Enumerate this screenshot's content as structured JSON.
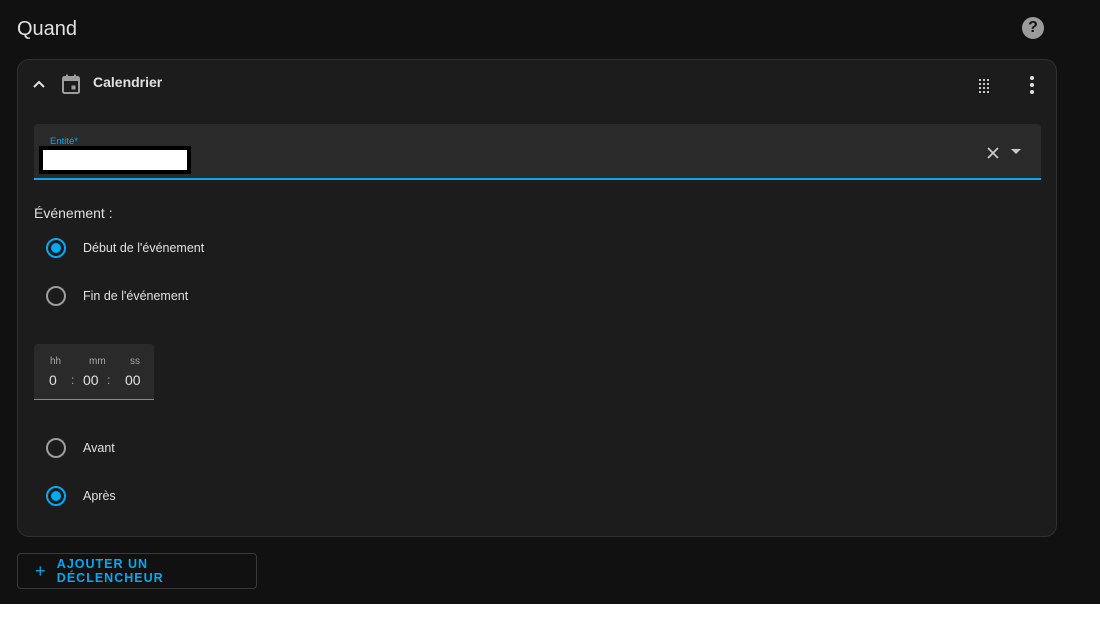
{
  "section": {
    "title": "Quand"
  },
  "trigger_card": {
    "title": "Calendrier",
    "entity_field": {
      "label": "Entité*",
      "value": ""
    },
    "event": {
      "label": "Événement :",
      "options": [
        {
          "label": "Début de l'événement",
          "checked": true
        },
        {
          "label": "Fin de l'événement",
          "checked": false
        }
      ]
    },
    "offset": {
      "units": {
        "hh": "hh",
        "mm": "mm",
        "ss": "ss"
      },
      "values": {
        "hh": "0",
        "mm": "00",
        "ss": "00"
      },
      "separator": ":"
    },
    "direction": {
      "options": [
        {
          "label": "Avant",
          "checked": false
        },
        {
          "label": "Après",
          "checked": true
        }
      ]
    }
  },
  "actions": {
    "add_trigger_label": "AJOUTER UN DÉCLENCHEUR",
    "add_icon": "+"
  },
  "icons": [
    "help-icon",
    "chevron-up-icon",
    "calendar-icon",
    "drag-handle-icon",
    "more-vertical-icon",
    "clear-icon",
    "dropdown-arrow-icon",
    "plus-icon"
  ],
  "colors": {
    "accent": "#03a9f4",
    "background": "#111111",
    "card": "#1c1c1c",
    "field": "#2a2a2a",
    "text": "#e1e1e1"
  }
}
